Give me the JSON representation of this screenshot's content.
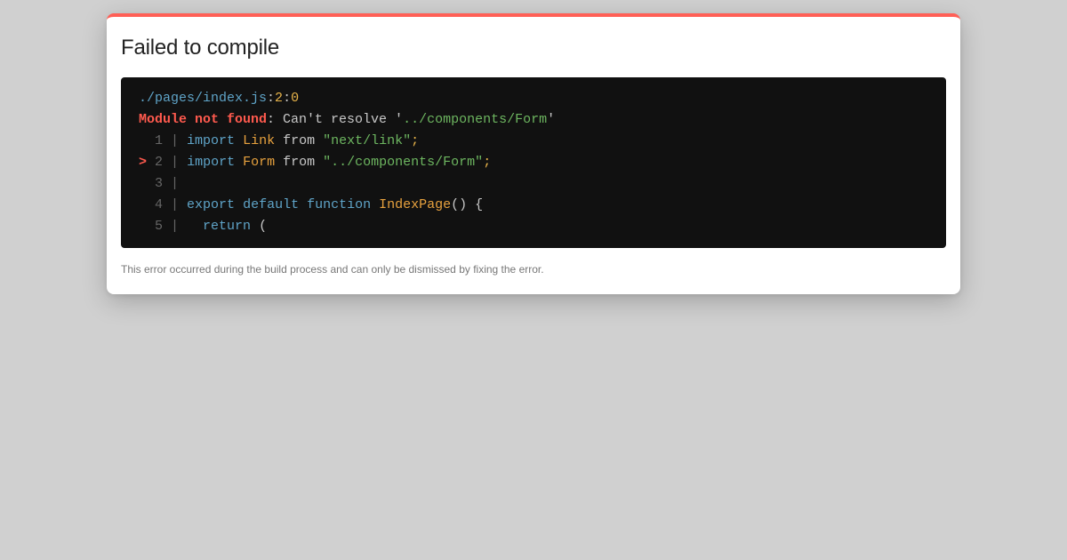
{
  "accent_color": "#ff5f56",
  "dialog": {
    "title": "Failed to compile",
    "footer": "This error occurred during the build process and can only be dismissed by fixing the error."
  },
  "error": {
    "file": "./pages/index.js",
    "line": "2",
    "column": "0",
    "label": "Module not found",
    "message_prefix": ": Can't resolve '",
    "module": "../components/Form",
    "message_suffix": "'"
  },
  "code_frame": {
    "marker": ">",
    "lines": [
      {
        "num": "1",
        "t1": "import",
        "t2": "Link",
        "t3": "from",
        "t4": "\"next/link\"",
        "t5": ";"
      },
      {
        "num": "2",
        "t1": "import",
        "t2": "Form",
        "t3": "from",
        "t4": "\"../components/Form\"",
        "t5": ";"
      },
      {
        "num": "3"
      },
      {
        "num": "4",
        "t1": "export",
        "t2": "default",
        "t3": "function",
        "t4": "IndexPage",
        "t5": "() {"
      },
      {
        "num": "5",
        "t1": "return",
        "t2": "("
      }
    ]
  }
}
